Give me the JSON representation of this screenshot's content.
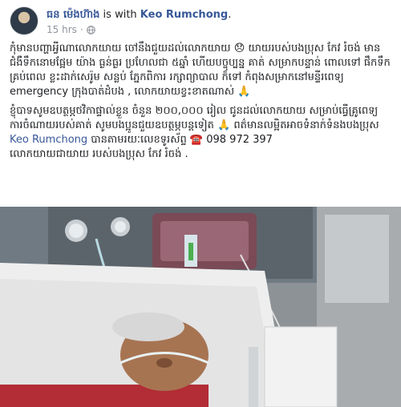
{
  "post": {
    "author": "ធន ម៉េងហ៊ាង",
    "with_text": " is with ",
    "tagged_person": "Keo Rumchong",
    "tagged_suffix": ".",
    "time": "15 hrs",
    "separator": "·",
    "privacy_icon": "globe-icon"
  },
  "body": {
    "paragraph1_part1": "កុំមានបញ្ហាអ្វីណាលោកយាយ ចៅនឹងជួយដល់លោកយាយ ",
    "emoji_sad": "😞",
    "paragraph1_part2": " យាយរបស់បងប្រុស កែវ រំចង់ មានជំងឺទឹកនោមផ្អែម យ៉ាង ធ្ងន់ធ្ងរ ប្រហែលជា ៥ឆ្នាំ ហើយបច្ចុប្បន្ន គាត់ សម្រាកបន្ទាន់ ពោលទៅ ផឹកទឹកគ្រប់ពេល ខ្លះដាក់សេរ៉ូម សន្លប់ ភ្នែកពិការ រក្សាព្យាបាល ក៏ទៅ កំពុងសម្រាកនៅមន្ទីរពេទ្យ emergency ក្រុងបាត់ដំបង , លោកយាយខ្វះខាតណាស់ ",
    "emoji_pray": "🙏",
    "paragraph2_part1": "ខ្ញុំបាទសូមឧបត្ថម្ភថវិកាផ្ទាល់ខ្លួន ចំនួន ២០០,០០០ រៀល ជូនដល់លោកយាយ សម្រាប់ធ្វើគ្រូពេទ្យ ការចំណាយរបស់គាត់ សូមបងប្អូនជួយឧបត្ថម្ភបន្តទៀត ",
    "emoji_pray2": "🙏",
    "paragraph2_part2": " ពត៌មានលម្អិតអាចទំនាក់ទំនងបងប្រុស ",
    "paragraph2_link": "Keo Rumchong",
    "paragraph2_part3": " បានតាមរយៈលេខទូរស័ព្ទ ",
    "phone_icon": "phone-icon",
    "phone": "☎️ 098 972 397",
    "paragraph3": "លោកយាយជាយាយ របស់បងប្រុស កែវ រំចង់ ."
  },
  "photo": {
    "description_icon": "hospital-photo"
  }
}
